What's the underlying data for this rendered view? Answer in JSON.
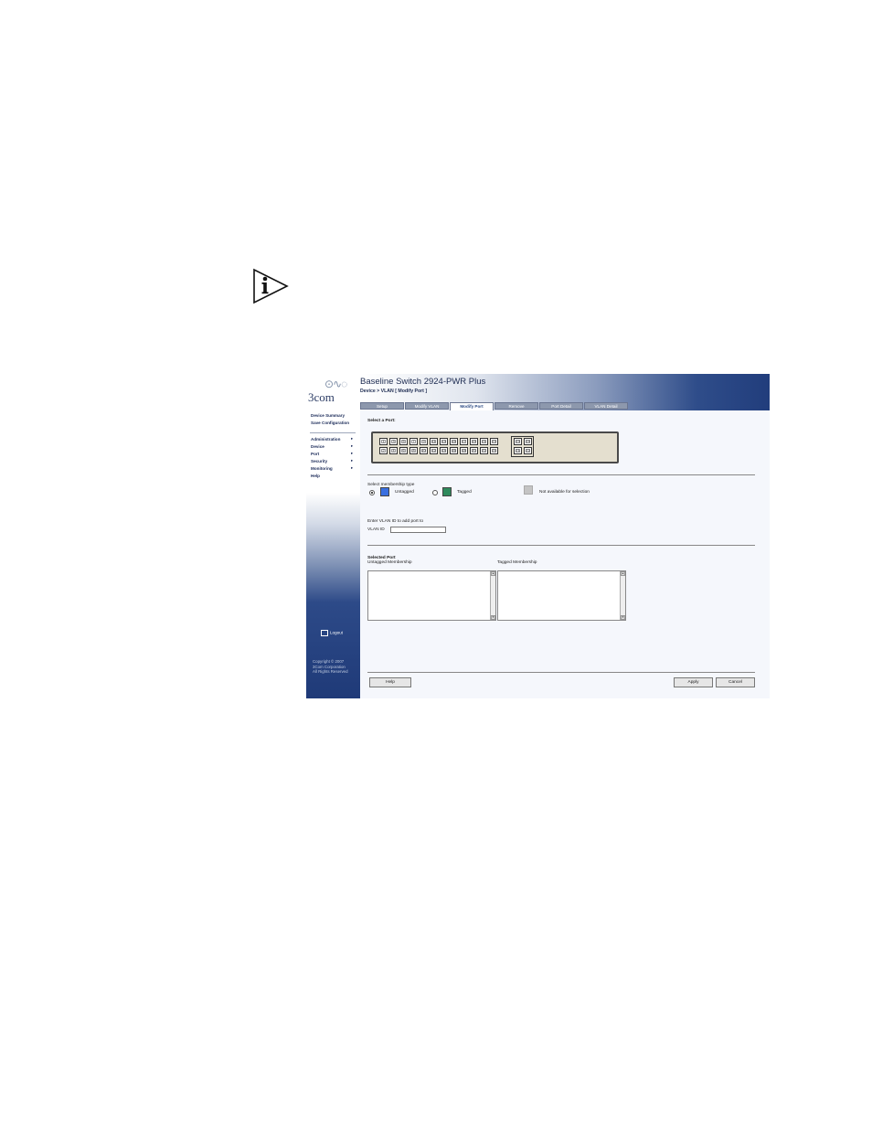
{
  "icons": {
    "info": "info-icon",
    "logout": "logout-icon",
    "logo_mark": "3com-logo-mark"
  },
  "app": {
    "logo": "3com",
    "title": "Baseline Switch 2924-PWR Plus",
    "breadcrumb": "Device > VLAN [ Modify Port ]"
  },
  "sidebar": {
    "links": [
      "Device Summary",
      "Save Configuration"
    ],
    "menu": [
      "Administration",
      "Device",
      "Port",
      "Security",
      "Monitoring",
      "Help"
    ],
    "logout": "Logout",
    "copyright": [
      "Copyright © 2007",
      "3Com Corporation",
      "All Rights Reserved"
    ]
  },
  "tabs": [
    "Setup",
    "Modify VLAN",
    "Modify Port",
    "Remove",
    "Port Detail",
    "VLAN Detail"
  ],
  "active_tab": "Modify Port",
  "port_select": {
    "label": "Select a Port:",
    "ports_top": [
      "1",
      "3",
      "5",
      "7",
      "9",
      "11",
      "13",
      "15",
      "17",
      "19",
      "21",
      "23"
    ],
    "ports_bottom": [
      "2",
      "4",
      "6",
      "8",
      "10",
      "12",
      "14",
      "16",
      "18",
      "20",
      "22",
      "24"
    ],
    "uplinks_top": [
      "23",
      "24"
    ],
    "uplinks_bottom": [
      "21",
      "22"
    ]
  },
  "membership": {
    "label": "Select membership type",
    "untagged": "Untagged",
    "tagged": "Tagged",
    "not_available": "Not available for selection",
    "selected": "Untagged",
    "colors": {
      "untagged": "#3a6fe0",
      "tagged": "#2f8a5c",
      "not_available": "#c4c4c4"
    }
  },
  "vlan": {
    "prompt": "Enter VLAN ID to add port to",
    "field_label": "VLAN ID",
    "value": ""
  },
  "selected_port": {
    "label": "Selected Port",
    "untagged_label": "Untagged Membership",
    "tagged_label": "Tagged Membership"
  },
  "buttons": {
    "help": "Help",
    "apply": "Apply",
    "cancel": "Cancel"
  }
}
